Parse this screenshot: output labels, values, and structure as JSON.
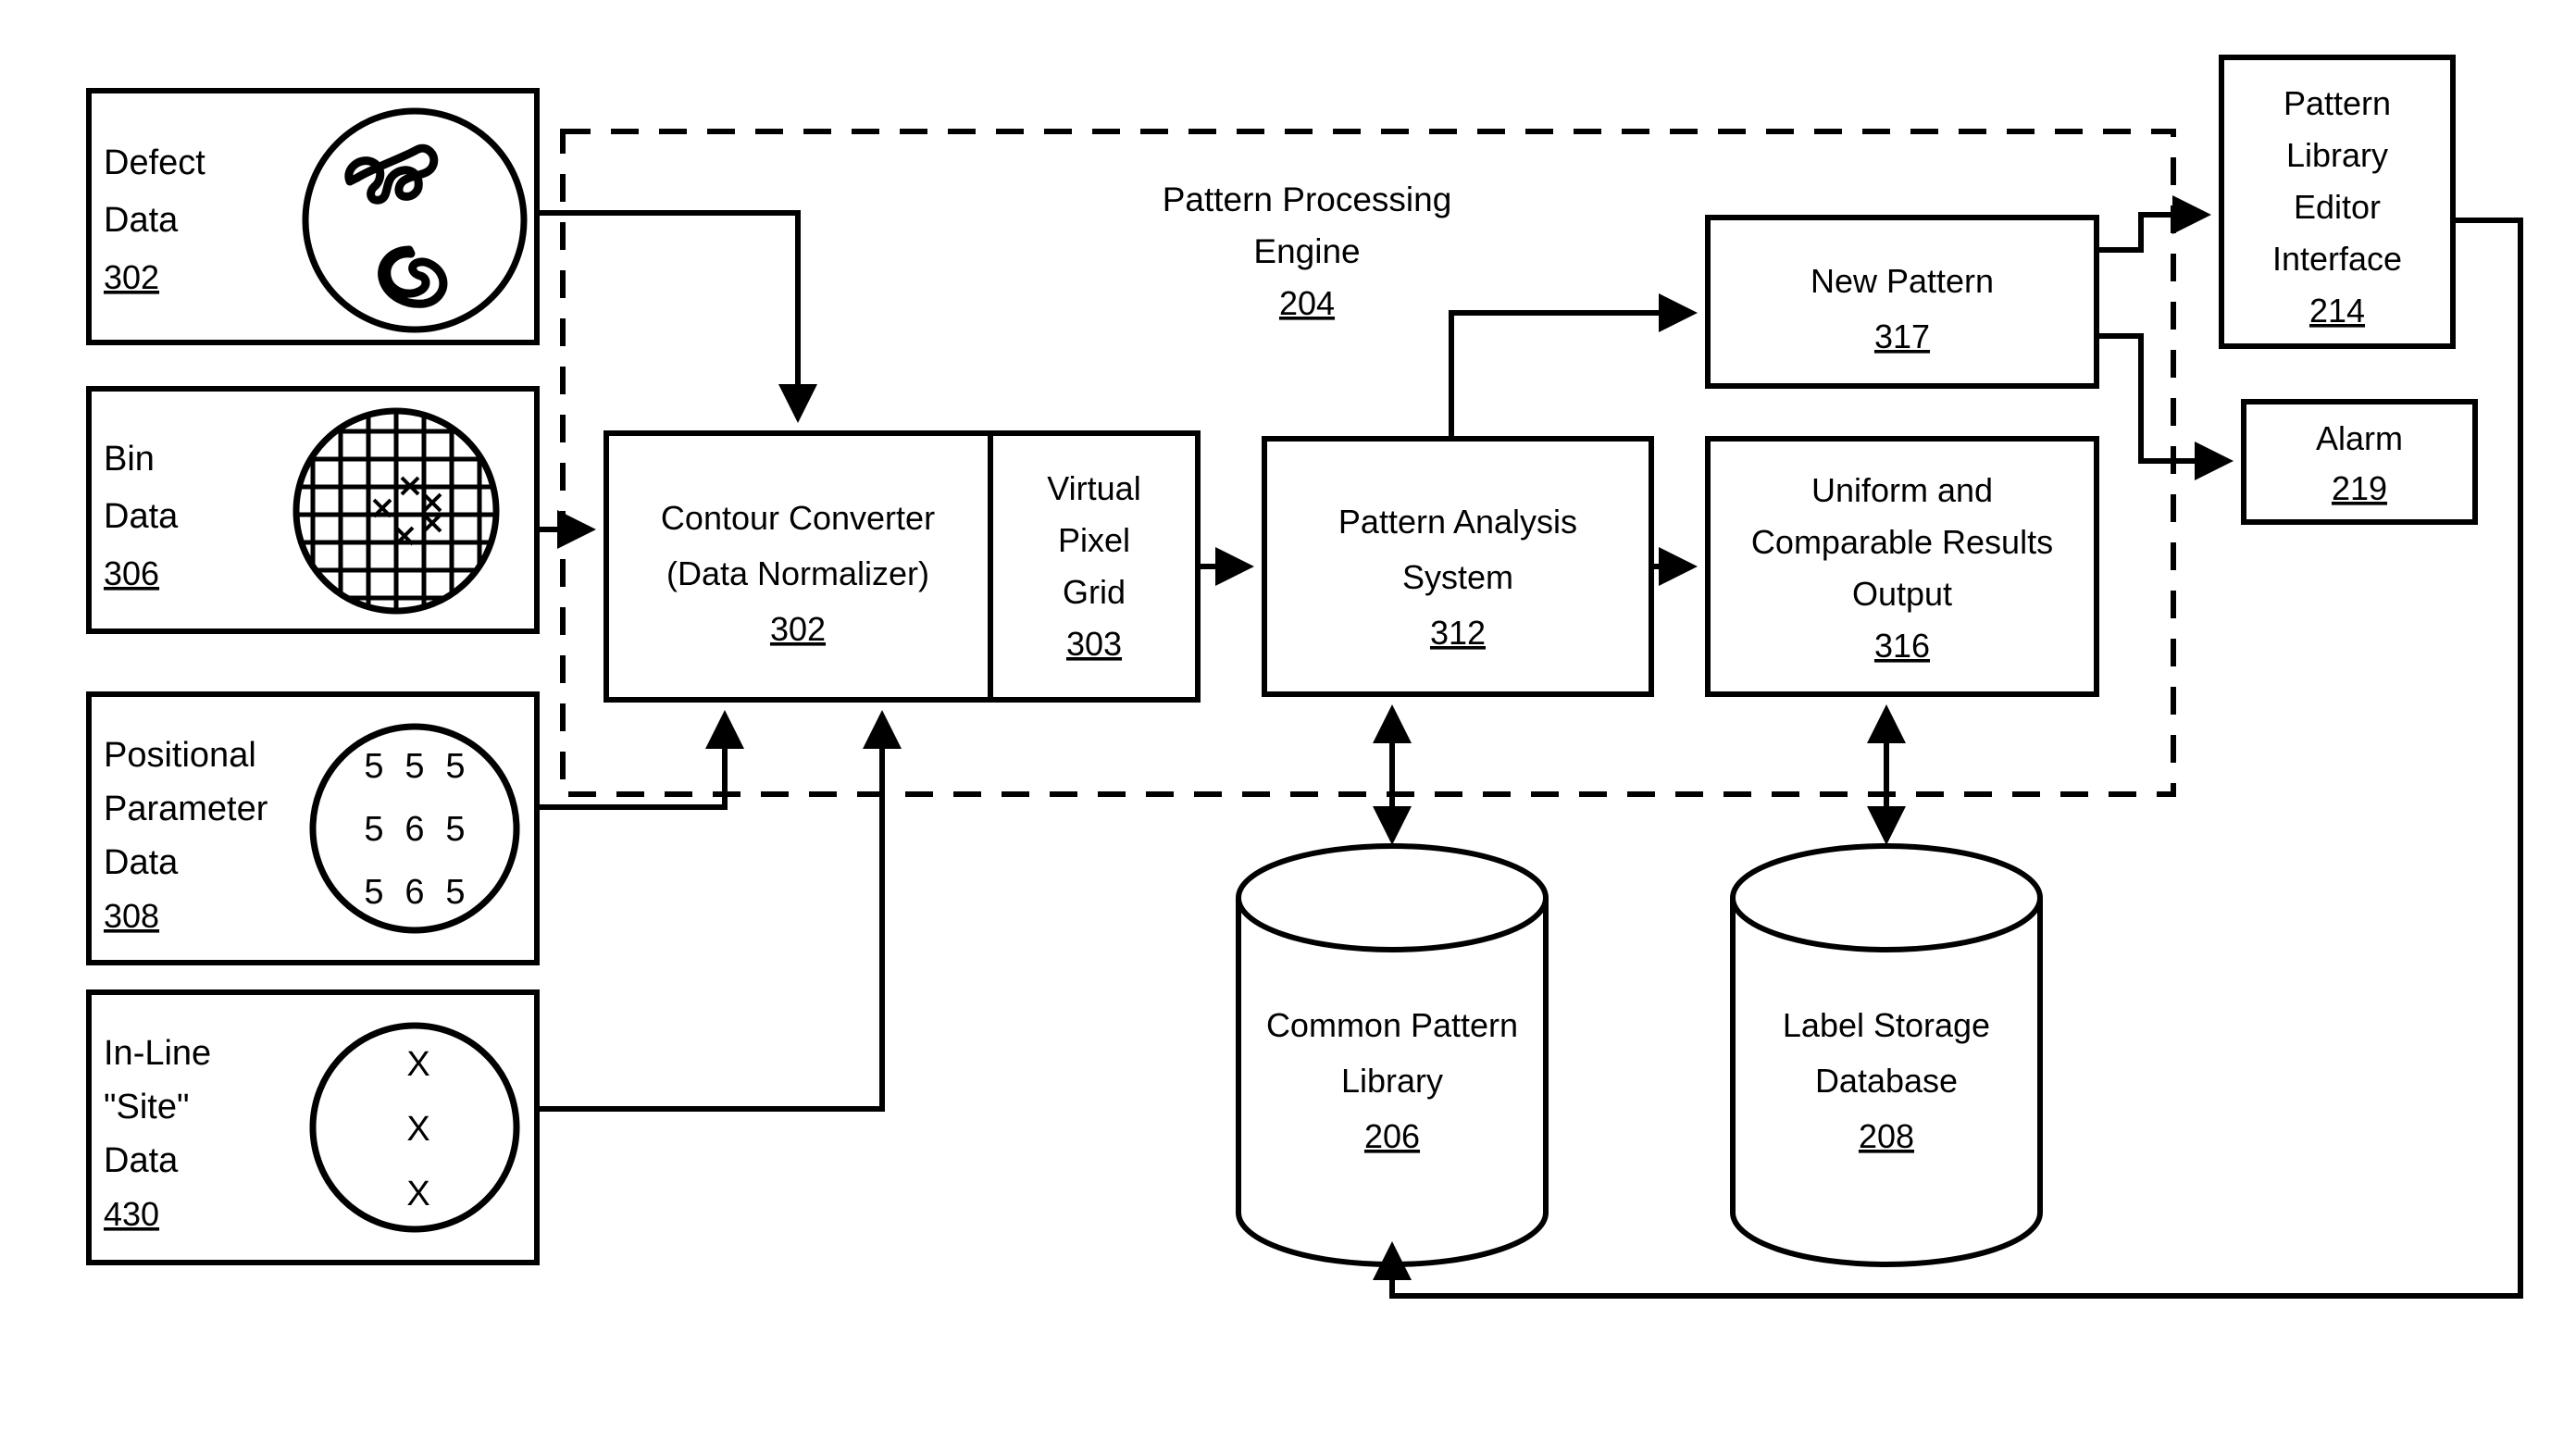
{
  "figure": {
    "title": "Pattern Processing Engine block diagram",
    "background_color": "#ffffff",
    "line_color": "#000000"
  },
  "region": {
    "engine_label_line1": "Pattern Processing",
    "engine_label_line2": "Engine",
    "engine_ref": "204",
    "boundary_style": "dashed"
  },
  "inputs": [
    {
      "id": "defect-data",
      "line1": "Defect",
      "line2": "Data",
      "ref": "302",
      "graphic": "wafer-with-defect-blobs"
    },
    {
      "id": "bin-data",
      "line1": "Bin",
      "line2": "Data",
      "ref": "306",
      "graphic": "wafer-with-bin-grid"
    },
    {
      "id": "positional-parameter-data",
      "line1": "Positional",
      "line2": "Parameter",
      "line3": "Data",
      "ref": "308",
      "graphic": "wafer-with-numbers",
      "values": [
        [
          "5",
          "5",
          "5"
        ],
        [
          "5",
          "6",
          "5"
        ],
        [
          "5",
          "6",
          "5"
        ]
      ]
    },
    {
      "id": "in-line-site-data",
      "line1": "In-Line",
      "line2": "\"Site\"",
      "line3": "Data",
      "ref": "430",
      "graphic": "wafer-with-x-marks",
      "marks": [
        "X",
        "X",
        "X"
      ]
    }
  ],
  "blocks": {
    "contour_converter": {
      "line1": "Contour Converter",
      "line2": "(Data Normalizer)",
      "ref": "302"
    },
    "virtual_pixel_grid": {
      "line1": "Virtual",
      "line2": "Pixel",
      "line3": "Grid",
      "ref": "303"
    },
    "pattern_analysis_system": {
      "line1": "Pattern Analysis",
      "line2": "System",
      "ref": "312"
    },
    "new_pattern": {
      "line1": "New Pattern",
      "ref": "317"
    },
    "uniform_results": {
      "line1": "Uniform and",
      "line2": "Comparable Results",
      "line3": "Output",
      "ref": "316"
    },
    "pattern_library_editor": {
      "line1": "Pattern",
      "line2": "Library",
      "line3": "Editor",
      "line4": "Interface",
      "ref": "214"
    },
    "alarm": {
      "line1": "Alarm",
      "ref": "219"
    }
  },
  "databases": {
    "common_pattern_library": {
      "line1": "Common Pattern",
      "line2": "Library",
      "ref": "206",
      "shape": "cylinder"
    },
    "label_storage_database": {
      "line1": "Label Storage",
      "line2": "Database",
      "ref": "208",
      "shape": "cylinder"
    }
  }
}
